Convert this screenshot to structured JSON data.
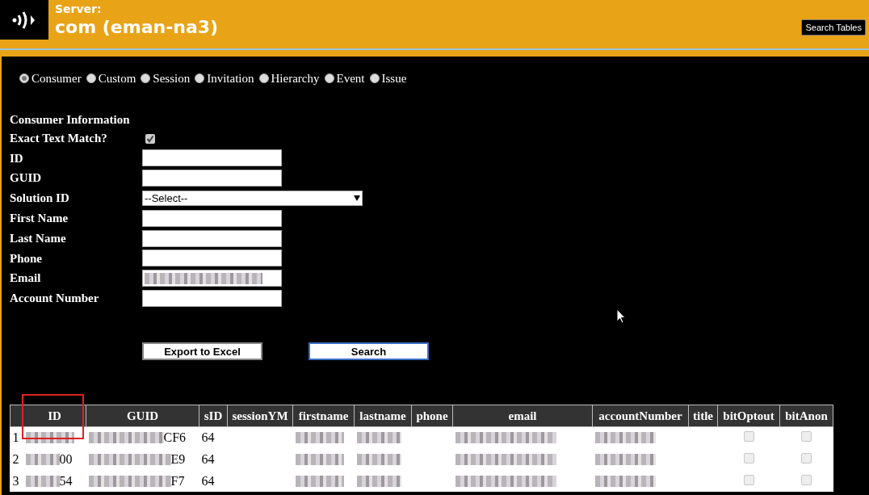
{
  "header": {
    "label": "Server:",
    "server": "com (eman-na3)",
    "button": "Search Tables"
  },
  "search_types": [
    {
      "label": "Consumer",
      "selected": true
    },
    {
      "label": "Custom",
      "selected": false
    },
    {
      "label": "Session",
      "selected": false
    },
    {
      "label": "Invitation",
      "selected": false
    },
    {
      "label": "Hierarchy",
      "selected": false
    },
    {
      "label": "Event",
      "selected": false
    },
    {
      "label": "Issue",
      "selected": false
    }
  ],
  "form": {
    "title": "Consumer Information",
    "exact_match": {
      "label": "Exact Text Match?",
      "checked": true
    },
    "fields": [
      {
        "label": "ID",
        "kind": "text"
      },
      {
        "label": "GUID",
        "kind": "text"
      },
      {
        "label": "Solution ID",
        "kind": "select",
        "value": "--Select--"
      },
      {
        "label": "First Name",
        "kind": "text"
      },
      {
        "label": "Last Name",
        "kind": "text"
      },
      {
        "label": "Phone",
        "kind": "text"
      },
      {
        "label": "Email",
        "kind": "text",
        "redacted": true
      },
      {
        "label": "Account Number",
        "kind": "text"
      }
    ],
    "buttons": [
      {
        "label": "Export to Excel",
        "focused": false
      },
      {
        "label": "Search",
        "focused": true
      }
    ]
  },
  "table": {
    "columns": [
      {
        "label": "ID",
        "highlighted": true
      },
      {
        "label": "GUID",
        "highlighted": false
      },
      {
        "label": "sID",
        "highlighted": false
      },
      {
        "label": "sessionYM",
        "highlighted": false
      },
      {
        "label": "firstname",
        "highlighted": false
      },
      {
        "label": "lastname",
        "highlighted": false
      },
      {
        "label": "phone",
        "highlighted": false
      },
      {
        "label": "email",
        "highlighted": false
      },
      {
        "label": "accountNumber",
        "highlighted": false
      },
      {
        "label": "title",
        "highlighted": false
      },
      {
        "label": "bitOptout",
        "highlighted": false
      },
      {
        "label": "bitAnon",
        "highlighted": false
      }
    ],
    "rows": [
      {
        "number": "1",
        "cells": [
          {
            "kind": "redacted"
          },
          {
            "kind": "redacted",
            "text": "CF6"
          },
          {
            "kind": "text",
            "text": "64"
          },
          {
            "kind": "empty"
          },
          {
            "kind": "redacted"
          },
          {
            "kind": "redacted"
          },
          {
            "kind": "empty"
          },
          {
            "kind": "redacted"
          },
          {
            "kind": "redacted"
          },
          {
            "kind": "empty"
          },
          {
            "kind": "checkbox",
            "checked": false
          },
          {
            "kind": "checkbox",
            "checked": false
          }
        ]
      },
      {
        "number": "2",
        "cells": [
          {
            "kind": "redacted",
            "text": "00"
          },
          {
            "kind": "redacted",
            "text": "E9"
          },
          {
            "kind": "text",
            "text": "64"
          },
          {
            "kind": "empty"
          },
          {
            "kind": "redacted"
          },
          {
            "kind": "redacted"
          },
          {
            "kind": "empty"
          },
          {
            "kind": "redacted"
          },
          {
            "kind": "redacted"
          },
          {
            "kind": "empty"
          },
          {
            "kind": "checkbox",
            "checked": false
          },
          {
            "kind": "checkbox",
            "checked": false
          }
        ]
      },
      {
        "number": "3",
        "cells": [
          {
            "kind": "redacted",
            "text": "54"
          },
          {
            "kind": "redacted",
            "text": "F7"
          },
          {
            "kind": "text",
            "text": "64"
          },
          {
            "kind": "empty"
          },
          {
            "kind": "redacted"
          },
          {
            "kind": "redacted"
          },
          {
            "kind": "empty"
          },
          {
            "kind": "redacted"
          },
          {
            "kind": "redacted"
          },
          {
            "kind": "empty"
          },
          {
            "kind": "checkbox",
            "checked": false
          },
          {
            "kind": "checkbox",
            "checked": false
          }
        ]
      }
    ]
  }
}
